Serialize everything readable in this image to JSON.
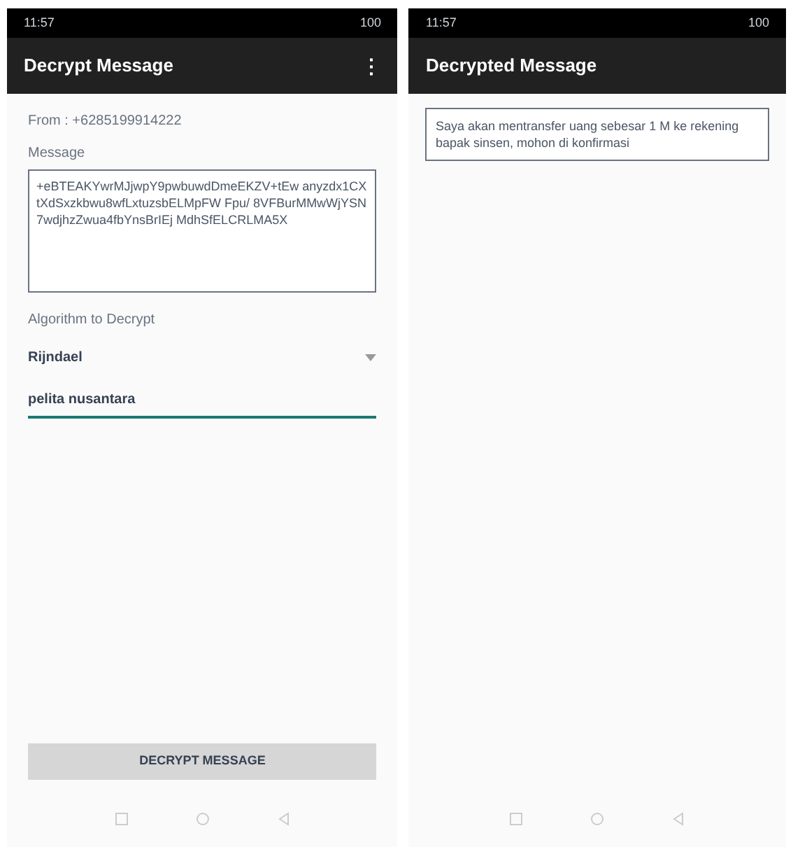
{
  "screens": [
    {
      "status_bar": {
        "time": "11:57",
        "battery": "100"
      },
      "app_bar": {
        "title": "Decrypt Message",
        "menu": "⋮"
      },
      "from": "From :  +6285199914222",
      "message_label": "Message",
      "message": "+eBTEAKYwrMJjwpY9pwbuwdDmeEKZV+tEw anyzdx1CXtXdSxzkbwu8wfLxtuzsbELMpFW Fpu/ 8VFBurMMwWjYSN7wdjhzZwua4fbYnsBrIEj MdhSfELCRLMA5X",
      "algorithm_label": "Algorithm to Decrypt",
      "algorithm": "Rijndael",
      "key": "pelita nusantara",
      "button": "DECRYPT MESSAGE"
    },
    {
      "status_bar": {
        "time": "11:57",
        "battery": "100"
      },
      "app_bar": {
        "title": "Decrypted Message"
      },
      "result": "Saya akan mentransfer uang sebesar 1 M ke rekening bapak sinsen, mohon di konfirmasi"
    }
  ]
}
